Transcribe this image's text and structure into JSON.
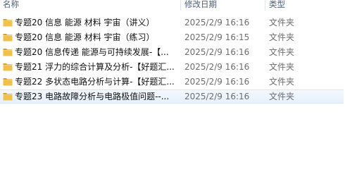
{
  "columns": {
    "name": "名称",
    "date": "修改日期",
    "type": "类型"
  },
  "files": [
    {
      "name": "专题20  信息 能源 材料 宇宙（讲义）",
      "date": "2025/2/9 16:16",
      "type": "文件夹",
      "icon": "folder-icon"
    },
    {
      "name": "专题20  信息 能源 材料 宇宙（练习）",
      "date": "2025/2/9 16:15",
      "type": "文件夹",
      "icon": "folder-icon"
    },
    {
      "name": "专题20 信息传递  能源与可持续发展-【...",
      "date": "2025/2/9 16:16",
      "type": "文件夹",
      "icon": "folder-icon"
    },
    {
      "name": "专题21 浮力的综合计算及分析-【好题汇...",
      "date": "2025/2/9 16:16",
      "type": "文件夹",
      "icon": "folder-icon"
    },
    {
      "name": "专题22 多状态电路分析与计算-【好题汇...",
      "date": "2025/2/9 16:16",
      "type": "文件夹",
      "icon": "folder-icon"
    },
    {
      "name": "专题23 电路故障分析与电路极值问题--...",
      "date": "2025/2/9 16:16",
      "type": "文件夹",
      "icon": "folder-icon",
      "selected": true
    }
  ],
  "colors": {
    "folder_body": "#e8b53a",
    "folder_tab": "#d9a026",
    "header_text": "#4c607a",
    "selection": "#e6f1fc"
  }
}
